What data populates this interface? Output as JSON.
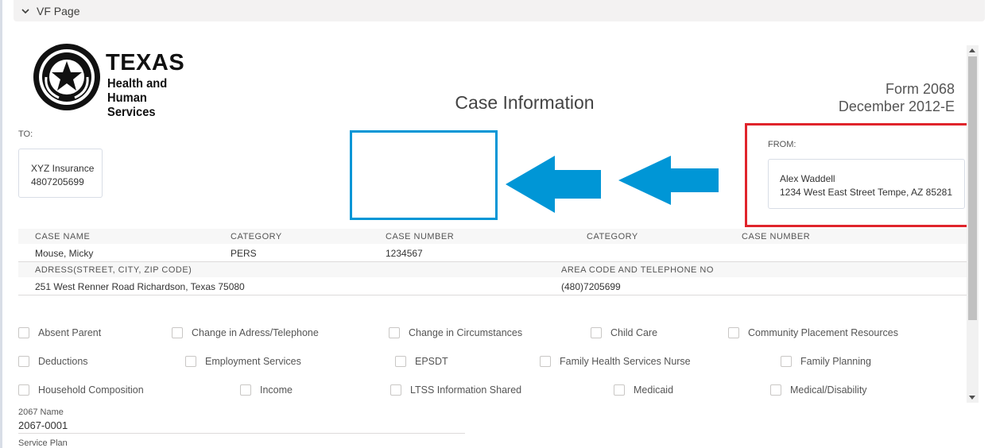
{
  "section": {
    "title": "VF Page",
    "icon": "chevron-down-icon"
  },
  "logo": {
    "texas": "TEXAS",
    "line1": "Health and Human",
    "line2": "Services"
  },
  "form": {
    "number": "Form 2068",
    "date": "December 2012-E"
  },
  "page_title": "Case Information",
  "to": {
    "label": "TO:",
    "name": "XYZ Insurance",
    "phone": "4807205699"
  },
  "from": {
    "label": "FROM:",
    "name": "Alex Waddell",
    "address": "1234 West East Street Tempe, AZ 85281"
  },
  "annotation_colors": {
    "blue": "#0096d6",
    "red": "#e0242b"
  },
  "case_table": {
    "row1_headers": [
      "CASE NAME",
      "CATEGORY",
      "CASE NUMBER",
      "CATEGORY",
      "CASE NUMBER"
    ],
    "row1_values": [
      "Mouse, Micky",
      "PERS",
      "1234567"
    ],
    "row2_headers": [
      "ADRESS(STREET, CITY, ZIP CODE)",
      "AREA CODE AND TELEPHONE NO"
    ],
    "row2_values": [
      "251 West Renner Road Richardson, Texas 75080",
      "(480)7205699"
    ]
  },
  "checkboxes": [
    [
      "Absent Parent",
      "Change in Adress/Telephone",
      "Change in Circumstances",
      "Child Care",
      "Community Placement Resources"
    ],
    [
      "Deductions",
      "Employment Services",
      "EPSDT",
      "Family Health Services Nurse",
      "Family Planning"
    ],
    [
      "Household Composition",
      "Income",
      "LTSS Information Shared",
      "Medicaid",
      "Medical/Disability"
    ]
  ],
  "fields": {
    "name_label": "2067 Name",
    "name_value": "2067-0001",
    "plan_label": "Service Plan"
  }
}
